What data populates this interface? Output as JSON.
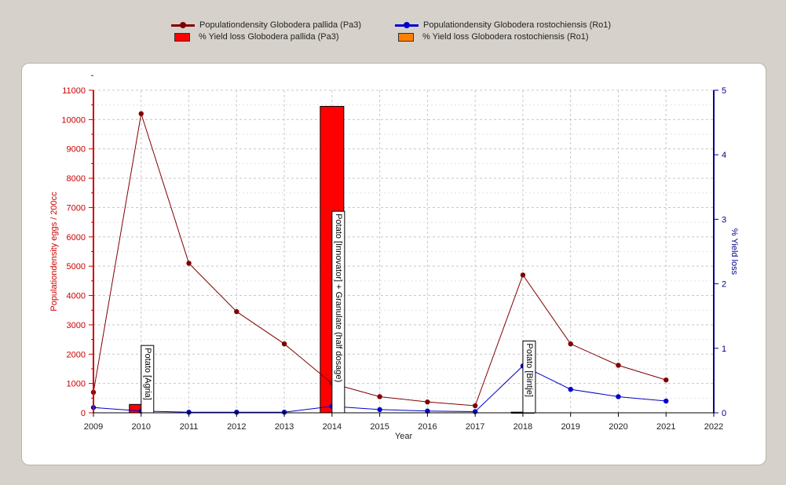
{
  "chart_data": {
    "type": "line",
    "title": "",
    "xlabel": "Year",
    "ylabel_left": "Populationdensity eggs / 200cc",
    "ylabel_right": "% Yield loss",
    "xlim": [
      2009,
      2022
    ],
    "ylim_left": [
      0,
      11000
    ],
    "ylim_right": [
      0,
      5
    ],
    "x_ticks": [
      2009,
      2010,
      2011,
      2012,
      2013,
      2014,
      2015,
      2016,
      2017,
      2018,
      2019,
      2020,
      2021,
      2022
    ],
    "y_left_ticks": [
      0,
      1000,
      2000,
      3000,
      4000,
      5000,
      6000,
      7000,
      8000,
      9000,
      10000,
      11000
    ],
    "y_right_ticks": [
      0,
      1,
      2,
      3,
      4,
      5
    ],
    "grid": true,
    "legend_position": "top",
    "series": [
      {
        "name": "Populationdensity Globodera pallida (Pa3)",
        "kind": "line",
        "axis": "left",
        "color": "#800000",
        "x": [
          2009,
          2010,
          2011,
          2012,
          2013,
          2014,
          2015,
          2016,
          2017,
          2018,
          2019,
          2020,
          2021
        ],
        "y": [
          700,
          10200,
          5100,
          3450,
          2350,
          1000,
          550,
          370,
          240,
          4700,
          2350,
          1620,
          1120
        ]
      },
      {
        "name": "Populationdensity Globodera rostochiensis (Ro1)",
        "kind": "line",
        "axis": "left",
        "color": "#0000cc",
        "x": [
          2009,
          2010,
          2011,
          2012,
          2013,
          2014,
          2015,
          2016,
          2017,
          2018,
          2019,
          2020,
          2021
        ],
        "y": [
          180,
          60,
          20,
          20,
          20,
          220,
          110,
          60,
          40,
          1600,
          800,
          550,
          400
        ]
      },
      {
        "name": "% Yield loss Globodera pallida (Pa3)",
        "kind": "bar",
        "axis": "right",
        "color": "#ff0000",
        "x": [
          2010,
          2014,
          2018
        ],
        "y": [
          0.13,
          4.75,
          0.01
        ]
      },
      {
        "name": "% Yield loss Globodera rostochiensis (Ro1)",
        "kind": "bar",
        "axis": "right",
        "color": "#ff8000",
        "x": [
          2010,
          2014,
          2018
        ],
        "y": [
          0.01,
          0.02,
          0.0
        ]
      }
    ],
    "annotations": [
      {
        "x": 2010,
        "text": "Potato [Agria]"
      },
      {
        "x": 2014,
        "text": "Potato [Innovator] + Granulate (half dosage)"
      },
      {
        "x": 2018,
        "text": "Potato [Bintje]"
      }
    ],
    "colors": {
      "left_axis": "#cc0000",
      "right_axis": "#00008b",
      "grid": "#c8c8c8"
    }
  }
}
